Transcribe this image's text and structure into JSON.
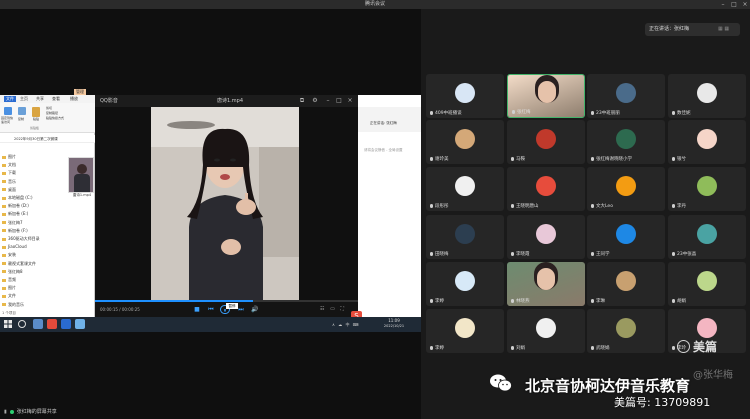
{
  "meeting": {
    "title": "腾讯会议"
  },
  "shared_screen": {
    "explorer": {
      "ribbon_tabs": [
        "文件",
        "主页",
        "共享",
        "查看",
        "播放"
      ],
      "manage_tab": "管理",
      "ribbon_labels": [
        "固定到快速访问",
        "复制",
        "粘贴",
        "剪切",
        "复制路径",
        "粘贴快捷方式"
      ],
      "ribbon_group": "剪贴板",
      "path": "2022年9月30日第二次微课",
      "nav_items": [
        "图片",
        "文档",
        "下载",
        "音乐",
        "桌面",
        "本地磁盘 (C:)",
        "新加卷 (D:)",
        "新加卷 (E:)",
        "张红梅7",
        "新加卷 (F:)",
        "360驱动大师目录",
        "JiaoCloud",
        "安装",
        "赖视式套课文件",
        "张红梅8",
        "音频",
        "图片",
        "文件",
        "我的音乐"
      ],
      "video_file": "唐诗1.mp4",
      "status": "1 个项目"
    },
    "player": {
      "app_name": "QQ影音",
      "file_name": "唐诗1.mp4",
      "time": "00:00:15 / 00:00:25",
      "progress": 0.6,
      "tooltip": "暂停"
    },
    "chat": {
      "speaker": "正在讲话: 张红梅",
      "mute_note": "请将会议静音 - 全局设置"
    },
    "taskbar": {
      "clock_time": "11:09",
      "clock_date": "2022/10/21",
      "tray": "∧ ☁ 中 ⌨"
    },
    "footer": "张红梅的屏幕共享"
  },
  "speaking_banner": "正在讲话：张红梅",
  "participants": [
    {
      "name": "409中班播谈",
      "mic": "on",
      "color": "#d8e6f5"
    },
    {
      "name": "张红梅",
      "mic": "on",
      "color": "#f3dcc8",
      "video": true,
      "active": true
    },
    {
      "name": "23中班丽丽",
      "mic": "on",
      "color": "#4a6b8a"
    },
    {
      "name": "数佳妮",
      "mic": "on",
      "color": "#e8e8e8"
    },
    {
      "name": "谢玲美",
      "mic": "on",
      "color": "#d4a878"
    },
    {
      "name": "马鞍",
      "mic": "on",
      "color": "#c0392b"
    },
    {
      "name": "张红梅谢晓晓小学",
      "mic": "on",
      "color": "#2d6a4f"
    },
    {
      "name": "银兮",
      "mic": "on",
      "color": "#f5d5c8"
    },
    {
      "name": "段彤彤",
      "mic": "on",
      "color": "#f0f0f0"
    },
    {
      "name": "王晓明唐山",
      "mic": "on",
      "color": "#e74c3c"
    },
    {
      "name": "文大Leo",
      "mic": "on",
      "color": "#f39c12"
    },
    {
      "name": "李丹",
      "mic": "on",
      "color": "#8fbc5a"
    },
    {
      "name": "田晓梅",
      "mic": "on",
      "color": "#2c3e50"
    },
    {
      "name": "李晓霞",
      "mic": "on",
      "color": "#e8c8d8"
    },
    {
      "name": "王同学",
      "mic": "on",
      "color": "#1e88e5"
    },
    {
      "name": "23中张晶",
      "mic": "on",
      "color": "#4aa3a3"
    },
    {
      "name": "李婷",
      "mic": "on",
      "color": "#d7e9f7"
    },
    {
      "name": "林晓燕",
      "mic": "on",
      "color": "#6d8c70",
      "video": true
    },
    {
      "name": "李琳",
      "mic": "on",
      "color": "#c8a070"
    },
    {
      "name": "胡娟",
      "mic": "on",
      "color": "#bcd78b"
    },
    {
      "name": "李婷",
      "mic": "on",
      "color": "#f2e6c8"
    },
    {
      "name": "刘娟",
      "mic": "on",
      "color": "#f0f0f0"
    },
    {
      "name": "武晓娟",
      "mic": "on",
      "color": "#9a9a60"
    },
    {
      "name": "李玲",
      "mic": "on",
      "color": "#f4b6c2"
    }
  ],
  "watermark": {
    "meipian": "美篇",
    "author": "@张华梅",
    "org": "北京音协柯达伊音乐教育",
    "id": "美篇号: 13709891"
  }
}
